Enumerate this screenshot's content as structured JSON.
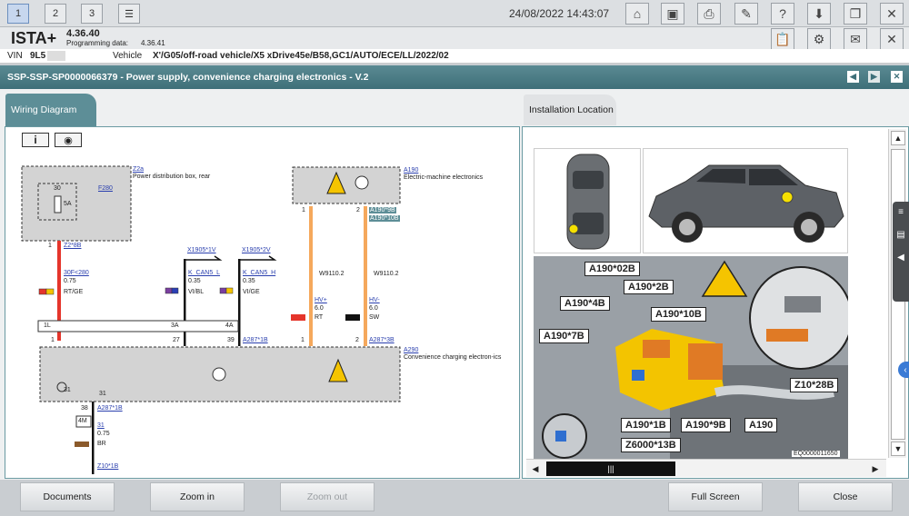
{
  "topbar": {
    "tabs": [
      "1",
      "2",
      "3"
    ],
    "datetime": "24/08/2022 14:43:07"
  },
  "header": {
    "app_name": "ISTA+",
    "version": "4.36.40",
    "programming_label": "Programming data:",
    "programming_version": "4.36.41",
    "vin_label": "VIN",
    "vin_value": "9L5",
    "vehicle_label": "Vehicle",
    "vehicle_value": "X'/G05/off-road vehicle/X5 xDrive45e/B58,GC1/AUTO/ECE/LL/2022/02"
  },
  "document": {
    "title": "SSP-SSP-SP0000066379 - Power supply, convenience charging electronics - V.2"
  },
  "tabs": {
    "wiring": "Wiring Diagram",
    "installation": "Installation Location"
  },
  "diagram": {
    "z2a": "Z2a",
    "z2a_desc": "Power distribution box, rear",
    "f280": "F280",
    "fuse_30": "30",
    "fuse_5a": "5A",
    "pin1": "1",
    "z2_8b": "Z2*8B",
    "w30f": "30F<280",
    "w30f_size": "0.75",
    "w30f_color": "RT/GE",
    "x1905_1v": "X1905*1V",
    "kcan5l": "K_CAN5_L",
    "kcan5l_size": "0.35",
    "kcan5l_color": "VI/BL",
    "x1905_2v": "X1905*2V",
    "kcan5h": "K_CAN5_H",
    "kcan5h_size": "0.35",
    "kcan5h_color": "VI/GE",
    "conn_1l": "1L",
    "conn_3a": "3A",
    "conn_4a": "4A",
    "pin_1b": "1",
    "pin_27": "27",
    "pin_39": "39",
    "a287_1b": "A287*1B",
    "a190": "A190",
    "a190_desc": "Electric-machine electronics",
    "a190_9b": "A190*9B",
    "a190_10b": "A190*10B",
    "pin_a190_1": "1",
    "pin_a190_2": "2",
    "w9110_a": "W9110.2",
    "w9110_b": "W9110.2",
    "hvp": "HV+",
    "hvp_size": "6.0",
    "hvp_color": "RT",
    "hvm": "HV-",
    "hvm_size": "6.0",
    "hvm_color": "SW",
    "pin_hv1": "1",
    "pin_hv2": "2",
    "a287_3b": "A287*3B",
    "a290": "A290",
    "a290_desc": "Convenience charging electron-ics",
    "pin_31a": "31",
    "pin_31b": "31",
    "pin_38": "38",
    "a287_1b_b": "A287*1B",
    "fourm": "4M",
    "w31": "31",
    "w31_size": "0.75",
    "w31_color": "BR",
    "z10_1b": "Z10*1B"
  },
  "install": {
    "labels": [
      "A190*02B",
      "A190*2B",
      "A190*4B",
      "A190*10B",
      "A190*7B",
      "Z10*28B",
      "A190*1B",
      "A190*9B",
      "A190",
      "Z6000*13B"
    ],
    "image_id": "EQ0000011650"
  },
  "buttons": {
    "documents": "Documents",
    "zoom_in": "Zoom in",
    "zoom_out": "Zoom out",
    "full_screen": "Full Screen",
    "close": "Close"
  },
  "colors": {
    "accent": "#4a7c86",
    "wire_red": "#e5352b",
    "wire_orange": "#f5a85c",
    "hv_yellow": "#f5c400"
  }
}
